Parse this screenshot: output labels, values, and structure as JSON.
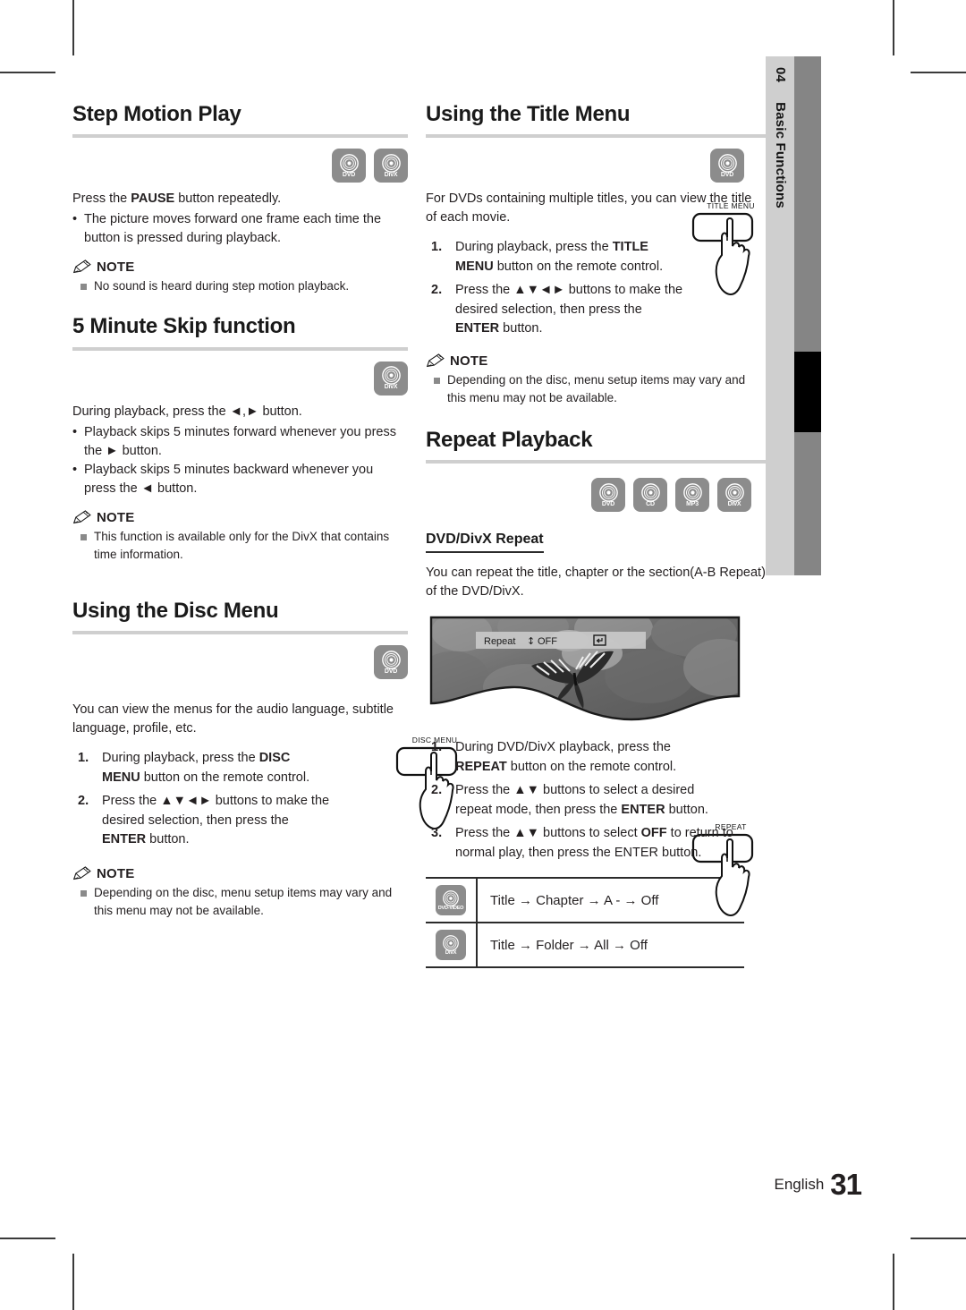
{
  "sidetab": {
    "chapter_number": "04",
    "chapter_label": "Basic Functions"
  },
  "footer": {
    "language": "English",
    "page_number": "31"
  },
  "note_label": "NOTE",
  "left_column": {
    "section1": {
      "heading": "Step Motion Play",
      "badges": [
        {
          "name": "disc-badge-dvd",
          "label": "DVD"
        },
        {
          "name": "disc-badge-divx",
          "label": "DivX"
        }
      ],
      "intro_pre": "Press the ",
      "intro_bold": "PAUSE",
      "intro_post": " button repeatedly.",
      "bullets": [
        "The picture moves forward one frame each time the button is pressed during playback."
      ],
      "notes": [
        "No sound is heard during step motion playback."
      ]
    },
    "section2": {
      "heading": "5 Minute Skip function",
      "badges": [
        {
          "name": "disc-badge-divx",
          "label": "DivX"
        }
      ],
      "intro": "During playback, press the ◄,► button.",
      "bullets": [
        "Playback skips 5 minutes forward whenever you press the ► button.",
        "Playback skips 5 minutes backward whenever you press the ◄ button."
      ],
      "notes": [
        "This function is available only for the DivX that contains time information."
      ]
    },
    "section3": {
      "heading": "Using the Disc Menu",
      "badges": [
        {
          "name": "disc-badge-dvd",
          "label": "DVD"
        }
      ],
      "intro": "You can view the menus for the audio language, subtitle language, profile, etc.",
      "steps": [
        {
          "num": "1.",
          "pre": "During playback, press the ",
          "bold": "DISC MENU",
          "post": " button on the remote control."
        },
        {
          "num": "2.",
          "pre": "Press the ▲▼◄► buttons to make the desired selection, then press the ",
          "bold": "ENTER",
          "post": " button."
        }
      ],
      "remote_button_label": "DISC MENU",
      "notes": [
        "Depending on the disc, menu setup items may vary and this menu may not be available."
      ]
    }
  },
  "right_column": {
    "section1": {
      "heading": "Using the Title Menu",
      "badges": [
        {
          "name": "disc-badge-dvd",
          "label": "DVD"
        }
      ],
      "intro": "For DVDs containing multiple titles, you can view the title of each movie.",
      "steps": [
        {
          "num": "1.",
          "pre": "During playback, press the ",
          "bold": "TITLE MENU",
          "post": " button on the remote control."
        },
        {
          "num": "2.",
          "pre": "Press the ▲▼◄► buttons to make the desired selection, then press the ",
          "bold": "ENTER",
          "post": " button."
        }
      ],
      "remote_button_label": "TITLE MENU",
      "notes": [
        "Depending on the disc, menu setup items may vary and this menu may not be available."
      ]
    },
    "section2": {
      "heading": "Repeat Playback",
      "badges": [
        {
          "name": "disc-badge-dvd",
          "label": "DVD"
        },
        {
          "name": "disc-badge-cd",
          "label": "CD"
        },
        {
          "name": "disc-badge-mp3",
          "label": "MP3"
        },
        {
          "name": "disc-badge-divx",
          "label": "DivX"
        }
      ],
      "subheading": "DVD/DivX Repeat",
      "intro": "You can repeat the title, chapter or the section(A-B Repeat) of the DVD/DivX.",
      "osd": {
        "label": "Repeat",
        "updown_icon": "↕",
        "value": "OFF",
        "return_icon": "return-icon"
      },
      "steps": [
        {
          "num": "1.",
          "pre": "During DVD/DivX playback, press the ",
          "bold": "REPEAT",
          "post": " button on the remote control."
        },
        {
          "num": "2.",
          "pre": "Press the ▲▼ buttons to select a desired repeat mode, then press the ",
          "bold": "ENTER",
          "post": " button."
        },
        {
          "num": "3.",
          "pre": "Press the ▲▼ buttons to select ",
          "bold": "OFF",
          "post": " to return to normal play, then press the ENTER button."
        }
      ],
      "remote_button_label": "REPEAT",
      "table": [
        {
          "icon_label": "DVD-VIDEO",
          "sequence": "Title → Chapter → A - → Off"
        },
        {
          "icon_label": "DivX",
          "sequence": "Title → Folder → All → Off"
        }
      ]
    }
  }
}
